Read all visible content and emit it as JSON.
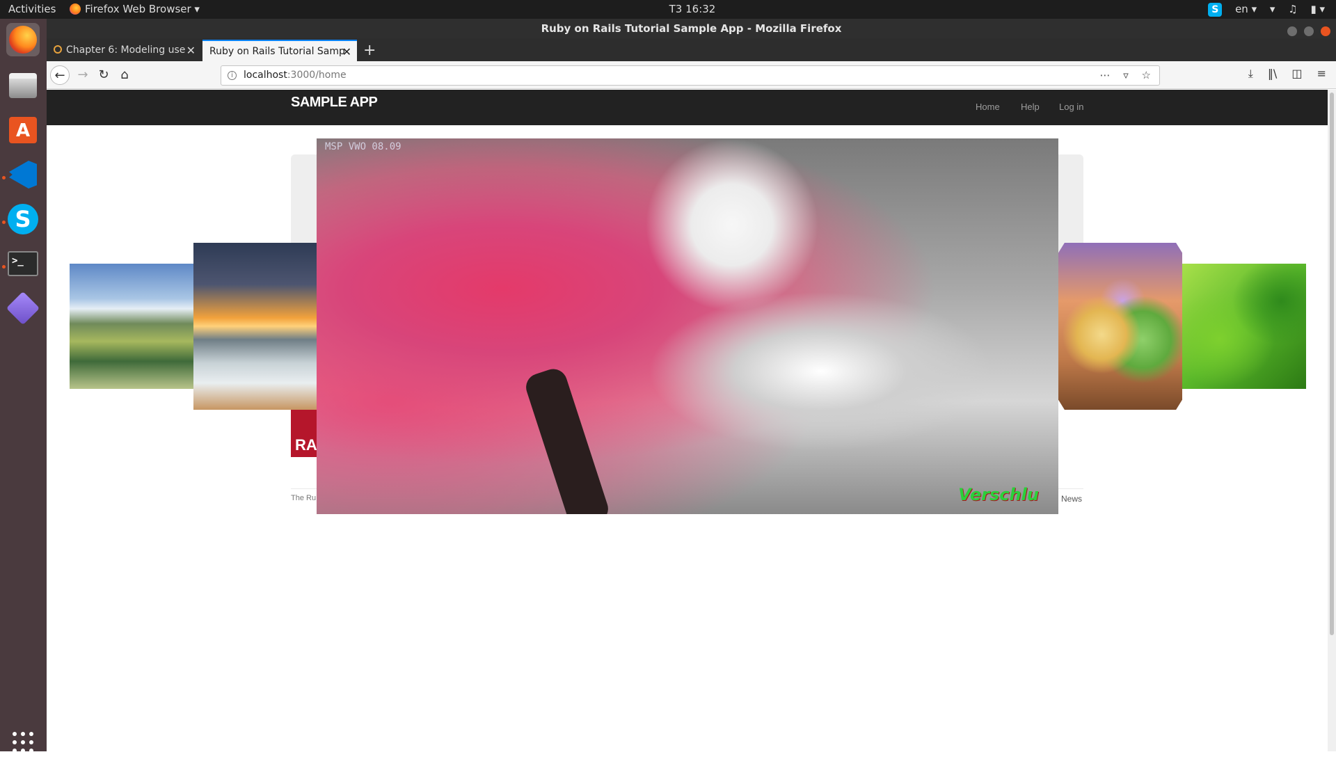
{
  "topbar": {
    "activities": "Activities",
    "app_menu": "Firefox Web Browser ▾",
    "clock": "T3 16:32",
    "tray_skype": "S",
    "tray_lang": "en ▾",
    "tray_wifi": "wifi-icon",
    "tray_volume": "volume-icon",
    "tray_power": "battery-icon"
  },
  "window": {
    "title": "Ruby on Rails Tutorial Sample App - Mozilla Firefox"
  },
  "tabs": [
    {
      "label": "Chapter 6: Modeling use",
      "active": false
    },
    {
      "label": "Ruby on Rails Tutorial Samp",
      "active": true
    }
  ],
  "navbar": {
    "url_host": "localhost",
    "url_path": ":3000/home"
  },
  "site": {
    "logo": "SAMPLE APP",
    "nav": {
      "home": "Home",
      "help": "Help",
      "login": "Log in"
    },
    "rails_logo_text": "RA",
    "footer_left": "The Ru",
    "footer_news": "News"
  },
  "carousel": {
    "main_stamp": "MSP VWO 08.09",
    "main_watermark": "Verschlu"
  },
  "colors": {
    "accent": "#e95420",
    "header_bg": "#222222",
    "tab_accent": "#0a84ff"
  }
}
